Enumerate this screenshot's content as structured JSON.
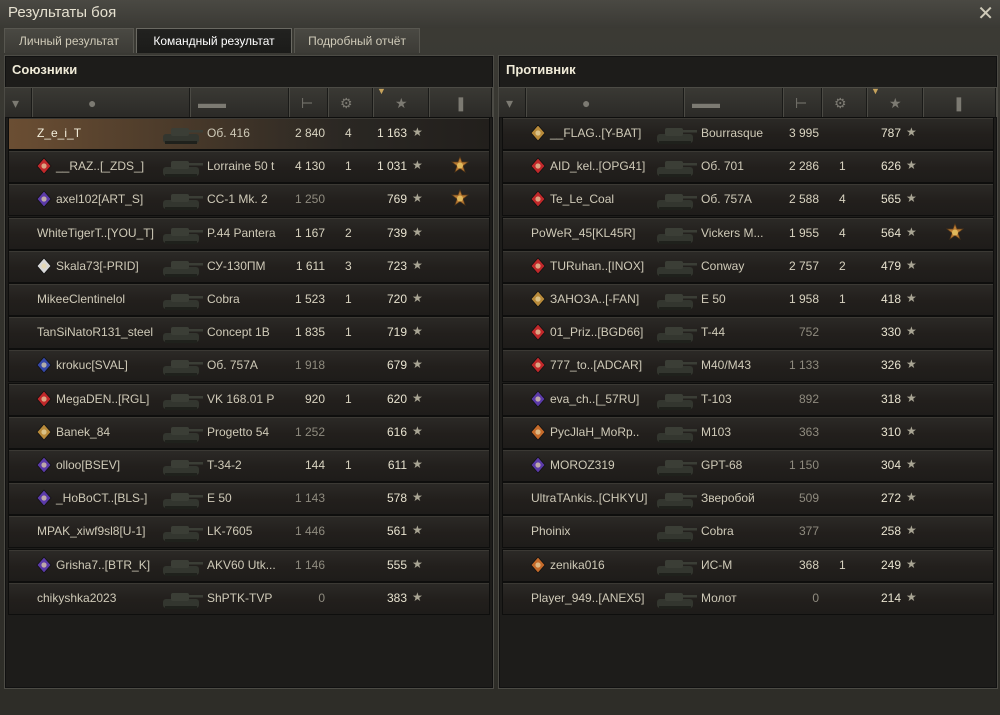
{
  "window": {
    "title": "Результаты боя",
    "close_glyph": "✕"
  },
  "tabs": [
    {
      "label": "Личный результат",
      "active": false
    },
    {
      "label": "Командный результат",
      "active": true
    },
    {
      "label": "Подробный отчёт",
      "active": false
    }
  ],
  "columns": {
    "icons": [
      "vehicle-type-icon",
      "player-icon",
      "tank-icon",
      "damage-icon",
      "kills-icon",
      "xp-star-icon",
      "medal-icon"
    ],
    "sorted_by": "xp"
  },
  "colors": {
    "accent": "#c7a35c",
    "self_row": "#6b4e33",
    "clan_red": "#c0282a",
    "clan_blue": "#3547a7"
  },
  "allies": {
    "title": "Союзники",
    "rows": [
      {
        "player": "Z_e_i_T",
        "clan_icon": "",
        "tank": "Об. 416",
        "damage": "2 840",
        "kills": "4",
        "xp": "1 163",
        "medal": false,
        "self": true
      },
      {
        "player": "__RAZ..[_ZDS_]",
        "clan_icon": "red",
        "tank": "Lorraine 50 t",
        "damage": "4 130",
        "kills": "1",
        "xp": "1 031",
        "medal": true,
        "self": false
      },
      {
        "player": "axel102[ART_S]",
        "clan_icon": "purple",
        "tank": "CC-1 Mk. 2",
        "damage": "1 250",
        "kills": "",
        "xp": "769",
        "medal": true,
        "self": false
      },
      {
        "player": "WhiteTigerT..[YOU_T]",
        "clan_icon": "",
        "tank": "P.44 Pantera",
        "damage": "1 167",
        "kills": "2",
        "xp": "739",
        "medal": false,
        "self": false
      },
      {
        "player": "Skala73[-PRID]",
        "clan_icon": "white",
        "tank": "СУ-130ПМ",
        "damage": "1 611",
        "kills": "3",
        "xp": "723",
        "medal": false,
        "self": false
      },
      {
        "player": "MikeeClentinelol",
        "clan_icon": "",
        "tank": "Cobra",
        "damage": "1 523",
        "kills": "1",
        "xp": "720",
        "medal": false,
        "self": false
      },
      {
        "player": "TanSiNatoR131_steel",
        "clan_icon": "",
        "tank": "Concept 1B",
        "damage": "1 835",
        "kills": "1",
        "xp": "719",
        "medal": false,
        "self": false
      },
      {
        "player": "krokuc[SVAL]",
        "clan_icon": "blue",
        "tank": "Об. 757А",
        "damage": "1 918",
        "kills": "",
        "xp": "679",
        "medal": false,
        "self": false
      },
      {
        "player": "MegaDEN..[RGL]",
        "clan_icon": "red",
        "tank": "VK 168.01 P",
        "damage": "920",
        "kills": "1",
        "xp": "620",
        "medal": false,
        "self": false
      },
      {
        "player": "Banek_84",
        "clan_icon": "gold",
        "tank": "Progetto 54",
        "damage": "1 252",
        "kills": "",
        "xp": "616",
        "medal": false,
        "self": false
      },
      {
        "player": "olloo[BSEV]",
        "clan_icon": "purple",
        "tank": "T-34-2",
        "damage": "144",
        "kills": "1",
        "xp": "611",
        "medal": false,
        "self": false
      },
      {
        "player": "_HoBoCT..[BLS-]",
        "clan_icon": "purple",
        "tank": "E 50",
        "damage": "1 143",
        "kills": "",
        "xp": "578",
        "medal": false,
        "self": false
      },
      {
        "player": "MPAK_xiwf9sl8[U-1]",
        "clan_icon": "",
        "tank": "LK-7605",
        "damage": "1 446",
        "kills": "",
        "xp": "561",
        "medal": false,
        "self": false
      },
      {
        "player": "Grisha7..[BTR_K]",
        "clan_icon": "purple",
        "tank": "AKV60 Utk...",
        "damage": "1 146",
        "kills": "",
        "xp": "555",
        "medal": false,
        "self": false
      },
      {
        "player": "chikyshka2023",
        "clan_icon": "",
        "tank": "ShPTK-TVP",
        "damage": "0",
        "kills": "",
        "xp": "383",
        "medal": false,
        "self": false
      }
    ]
  },
  "enemies": {
    "title": "Противник",
    "rows": [
      {
        "player": "__FLAG..[Y-BAT]",
        "clan_icon": "gold",
        "tank": "Bourrasque",
        "damage": "3 995",
        "kills": "",
        "xp": "787",
        "medal": false
      },
      {
        "player": "AID_kel..[OPG41]",
        "clan_icon": "red",
        "tank": "Об. 701",
        "damage": "2 286",
        "kills": "1",
        "xp": "626",
        "medal": false
      },
      {
        "player": "Te_Le_Coal",
        "clan_icon": "red",
        "tank": "Об. 757А",
        "damage": "2 588",
        "kills": "4",
        "xp": "565",
        "medal": false
      },
      {
        "player": "PoWeR_45[KL45R]",
        "clan_icon": "",
        "tank": "Vickers M...",
        "damage": "1 955",
        "kills": "4",
        "xp": "564",
        "medal": true
      },
      {
        "player": "TURuhan..[INOX]",
        "clan_icon": "red",
        "tank": "Conway",
        "damage": "2 757",
        "kills": "2",
        "xp": "479",
        "medal": false
      },
      {
        "player": "ЗАНОЗА..[-FAN]",
        "clan_icon": "gold",
        "tank": "E 50",
        "damage": "1 958",
        "kills": "1",
        "xp": "418",
        "medal": false
      },
      {
        "player": "01_Priz..[BGD66]",
        "clan_icon": "red",
        "tank": "T-44",
        "damage": "752",
        "kills": "",
        "xp": "330",
        "medal": false
      },
      {
        "player": "777_to..[ADCAR]",
        "clan_icon": "red",
        "tank": "M40/M43",
        "damage": "1 133",
        "kills": "",
        "xp": "326",
        "medal": false
      },
      {
        "player": "eva_ch..[_57RU]",
        "clan_icon": "purple",
        "tank": "T-103",
        "damage": "892",
        "kills": "",
        "xp": "318",
        "medal": false
      },
      {
        "player": "PycJlaH_MoRp..",
        "clan_icon": "orange",
        "tank": "M103",
        "damage": "363",
        "kills": "",
        "xp": "310",
        "medal": false
      },
      {
        "player": "MOROZ319",
        "clan_icon": "purple",
        "tank": "GPT-68",
        "damage": "1 150",
        "kills": "",
        "xp": "304",
        "medal": false
      },
      {
        "player": "UltraTAnkis..[CHKYU]",
        "clan_icon": "",
        "tank": "Зверобой",
        "damage": "509",
        "kills": "",
        "xp": "272",
        "medal": false
      },
      {
        "player": "Phoinix",
        "clan_icon": "",
        "tank": "Cobra",
        "damage": "377",
        "kills": "",
        "xp": "258",
        "medal": false
      },
      {
        "player": "zenika016",
        "clan_icon": "orange",
        "tank": "ИС-М",
        "damage": "368",
        "kills": "1",
        "xp": "249",
        "medal": false
      },
      {
        "player": "Player_949..[ANEX5]",
        "clan_icon": "",
        "tank": "Молот",
        "damage": "0",
        "kills": "",
        "xp": "214",
        "medal": false
      }
    ]
  }
}
